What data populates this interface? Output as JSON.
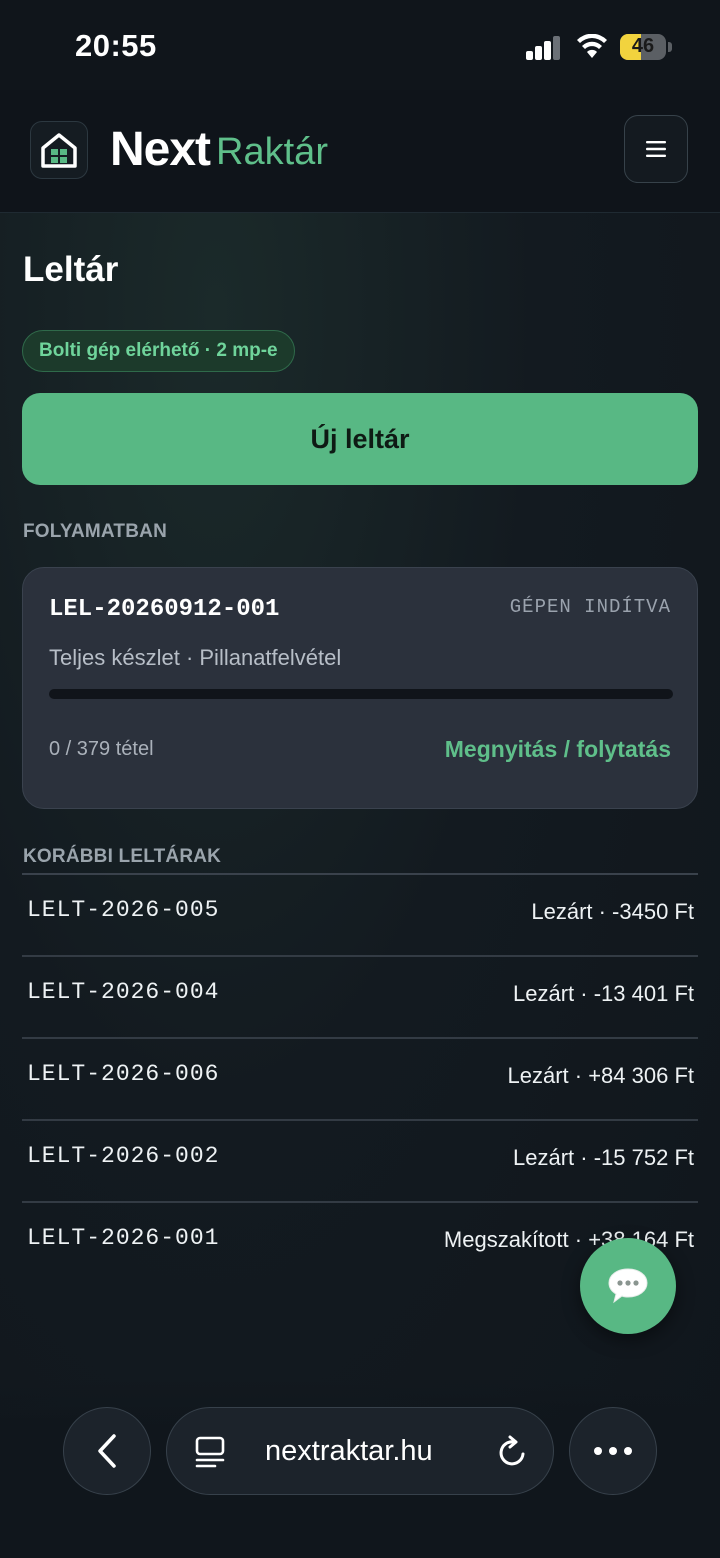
{
  "status_bar": {
    "time": "20:55",
    "battery": "46",
    "battery_level": 0.46
  },
  "header": {
    "brand_name": "Next",
    "brand_suffix": "Raktár",
    "menu_icon": "hamburger-icon"
  },
  "page": {
    "title": "Leltár",
    "badge": "Bolti gép elérhető · 2 mp-e",
    "new_button": "Új leltár"
  },
  "in_progress": {
    "section_label": "FOLYAMATBAN",
    "id": "LEL-20260912-001",
    "status": "GÉPEN INDÍTVA",
    "subtitle": "Teljes készlet · Pillanatfelvétel",
    "progress_fraction": 0,
    "count": "0 / 379 tétel",
    "action": "Megnyitás / folytatás"
  },
  "history": {
    "section_label": "KORÁBBI LELTÁRAK",
    "items": [
      {
        "id": "LELT-2026-005",
        "status": "Lezárt · -3450 Ft"
      },
      {
        "id": "LELT-2026-004",
        "status": "Lezárt · -13 401 Ft"
      },
      {
        "id": "LELT-2026-006",
        "status": "Lezárt · +84 306 Ft"
      },
      {
        "id": "LELT-2026-002",
        "status": "Lezárt · -15 752 Ft"
      },
      {
        "id": "LELT-2026-001",
        "status": "Megszakított · +38 164 Ft"
      }
    ]
  },
  "browser": {
    "url": "nextraktar.hu"
  },
  "colors": {
    "accent": "#58b884",
    "background": "#131a20",
    "card": "#2b313c"
  }
}
